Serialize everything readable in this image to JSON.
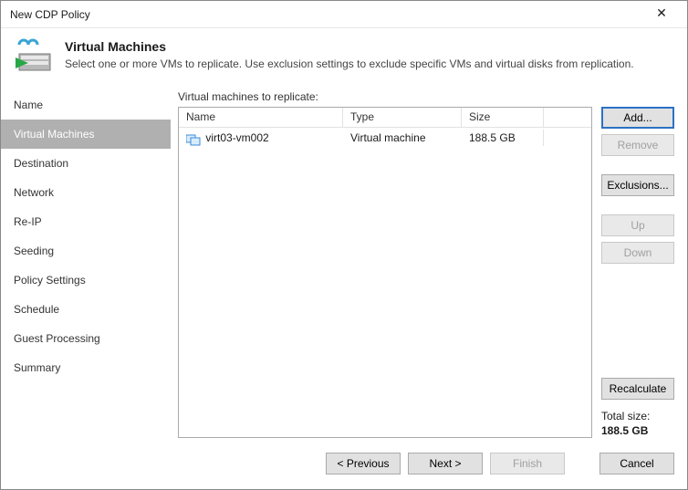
{
  "window": {
    "title": "New CDP Policy"
  },
  "header": {
    "title": "Virtual Machines",
    "subtitle": "Select one or more VMs to replicate. Use exclusion settings to exclude specific VMs and virtual disks from replication."
  },
  "sidebar": {
    "items": [
      {
        "label": "Name"
      },
      {
        "label": "Virtual Machines"
      },
      {
        "label": "Destination"
      },
      {
        "label": "Network"
      },
      {
        "label": "Re-IP"
      },
      {
        "label": "Seeding"
      },
      {
        "label": "Policy Settings"
      },
      {
        "label": "Schedule"
      },
      {
        "label": "Guest Processing"
      },
      {
        "label": "Summary"
      }
    ],
    "activeIndex": 1
  },
  "main": {
    "sectionLabel": "Virtual machines to replicate:",
    "columns": {
      "name": "Name",
      "type": "Type",
      "size": "Size"
    },
    "rows": [
      {
        "name": "virt03-vm002",
        "type": "Virtual machine",
        "size": "188.5 GB"
      }
    ],
    "buttons": {
      "add": "Add...",
      "remove": "Remove",
      "exclusions": "Exclusions...",
      "up": "Up",
      "down": "Down",
      "recalculate": "Recalculate"
    },
    "totalLabel": "Total size:",
    "totalValue": "188.5 GB"
  },
  "footer": {
    "previous": "< Previous",
    "next": "Next >",
    "finish": "Finish",
    "cancel": "Cancel"
  }
}
